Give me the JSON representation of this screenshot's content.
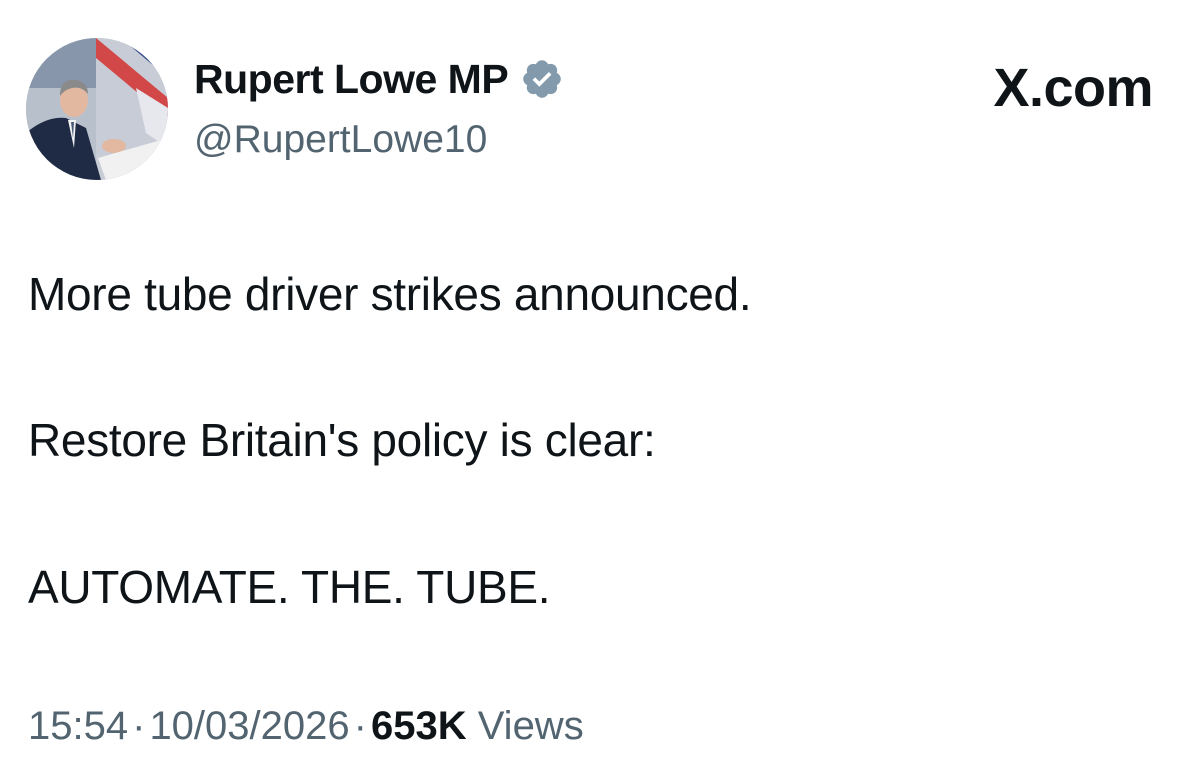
{
  "author": {
    "display_name": "Rupert Lowe MP",
    "handle": "@RupertLowe10",
    "verified_color": "#829aab"
  },
  "brand": {
    "label": "X.com"
  },
  "tweet": {
    "lines": [
      "More tube driver strikes announced.",
      "Restore Britain's policy is clear:",
      "AUTOMATE. THE. TUBE."
    ]
  },
  "meta": {
    "time": "15:54",
    "separator": "·",
    "date": "10/03/2026",
    "views_count": "653K",
    "views_label": "Views"
  },
  "colors": {
    "text": "#0f1419",
    "secondary": "#536471"
  },
  "icons": {
    "verified": "verified-badge-icon",
    "avatar": "profile-photo"
  }
}
